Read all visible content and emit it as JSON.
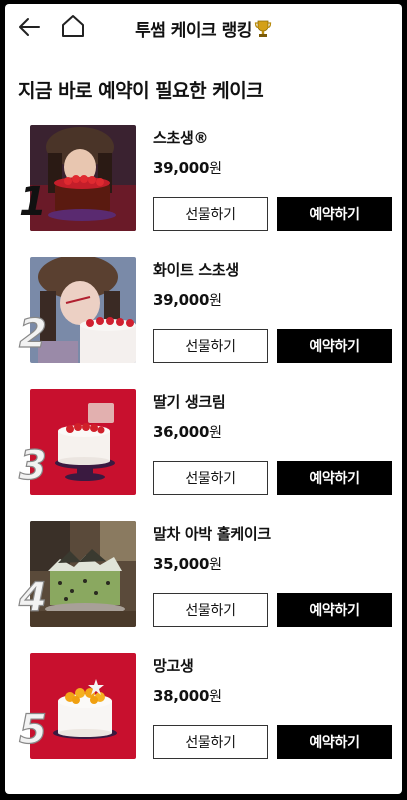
{
  "header": {
    "title": "투썸 케이크 랭킹",
    "back_icon": "arrow-left-icon",
    "home_icon": "home-icon",
    "trophy_icon": "trophy-icon"
  },
  "section_title": "지금 바로 예약이 필요한 케이크",
  "buttons": {
    "gift_label": "선물하기",
    "reserve_label": "예약하기"
  },
  "items": [
    {
      "rank": "1",
      "name": "스초생®",
      "price": "39,000",
      "currency": "원"
    },
    {
      "rank": "2",
      "name": "화이트 스초생",
      "price": "39,000",
      "currency": "원"
    },
    {
      "rank": "3",
      "name": "딸기 생크림",
      "price": "36,000",
      "currency": "원"
    },
    {
      "rank": "4",
      "name": "말차 아박 홀케이크",
      "price": "35,000",
      "currency": "원"
    },
    {
      "rank": "5",
      "name": "망고생",
      "price": "38,000",
      "currency": "원"
    }
  ],
  "colors": {
    "reserve_bg": "#000000",
    "background": "#ffffff",
    "thumb_red": "#c8102e"
  }
}
